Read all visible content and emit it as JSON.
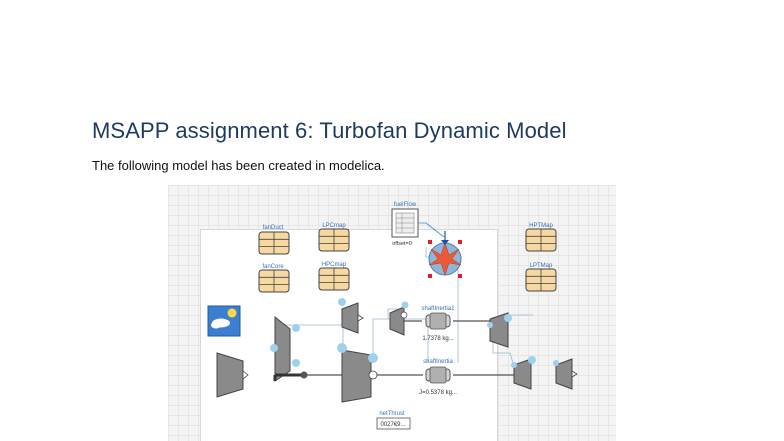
{
  "document": {
    "title": "MSAPP assignment 6: Turbofan Dynamic Model",
    "subtitle": "The following model has been created in modelica."
  },
  "diagram": {
    "tables": {
      "fanDuct": "fanDuct",
      "fanCore": "fanCore",
      "lpc_map": "LPCmap",
      "hpc_map": "HPCmap",
      "hpt_map": "HPTMap",
      "lpt_map": "LPTMap"
    },
    "fuel_flow": {
      "label": "fuelFlow",
      "value": "offset=0"
    },
    "shaft_inertia_1": {
      "label": "shaftInertia1",
      "value": "1.7378 kg..."
    },
    "shaft_inertia": {
      "label": "shaftInertia",
      "value": "J=0.5378 kg..."
    },
    "net_thrust": {
      "label": "netThrust",
      "value": "0027€9..."
    },
    "colors": {
      "table_fill": "#f6d8a0",
      "component_gray": "#8a8a8a",
      "port_blue": "#9fd0ec",
      "source_blue": "#4a90d9",
      "combustor_red": "#e85a3a"
    }
  }
}
